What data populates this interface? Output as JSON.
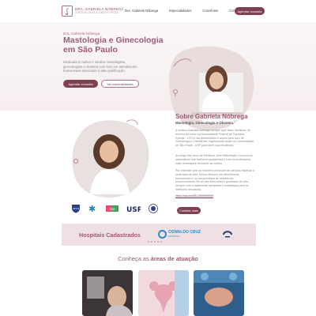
{
  "nav": {
    "logo_line1": "DRA. GABRIELA NÓBREGA",
    "logo_line2": "GINECOLOGIA & OBSTETRÍCIA",
    "links": [
      "Dra. Gabriela Nóbrega",
      "Especialidades",
      "Convênios",
      "Contato"
    ],
    "cta": "Agendar consulta"
  },
  "hero": {
    "eyebrow": "Dra. Gabriela Nóbrega",
    "title": "Mastologia e Ginecologia em São Paulo",
    "text": "Dedicada à mulher e médica mastologista, ginecologista e obstetra com foco em atendimento humanizado associado à alta qualificação.",
    "primary_button": "Agendar consulta",
    "secondary_button": "Ver especialidades"
  },
  "about": {
    "title": "Sobre Gabriela Nóbrega",
    "subtitle": "Mastologia, Ginecologia e Obstetra",
    "paragraphs": [
      "A médica Gabriela Nóbrega sempre quis fazer medicina. Ao término do curso na Universidade Federal de Campina Grande - UFCG ela desenvolveu o sonho pelo foco de Ginecologia e Obstetrícia, ingressando assim na Universidade de São Paulo - USP para fazer sua residência.",
      "Ao longo dos anos de Medicina, teve Mastologia e buscou se especializar nas melhores academias e com os professores mais renomados na saúde da mulher.",
      "Por entender que as mulheres precisam de atenção especial a cada fase da vida, busca oferecer um atendimento humanizado e no compromisso de excelência, proporcionando-lhe ao seu bem-estar e qualidade de vida, sempre com o tratamento adequado e estratégias para os melhores resultados."
    ],
    "link": "https://wa.me/5511999999999",
    "button": "Contatar mais"
  },
  "logos": [
    "UFCG",
    "Hospital",
    "SBM",
    "USP",
    "FEBRASGO"
  ],
  "hospitals": {
    "title": "Hospitais Cadastrados",
    "logo1_line1": "OSWALDO CRUZ",
    "logo1_line2": "HOSPITAL"
  },
  "areas": {
    "title_prefix": "Conheça as",
    "title_bold": "áreas de atuação"
  },
  "colors": {
    "accent": "#7d4150",
    "rose": "#a05a72",
    "hero_bg": "#f6eeef",
    "band_bg": "#efe0e3"
  }
}
